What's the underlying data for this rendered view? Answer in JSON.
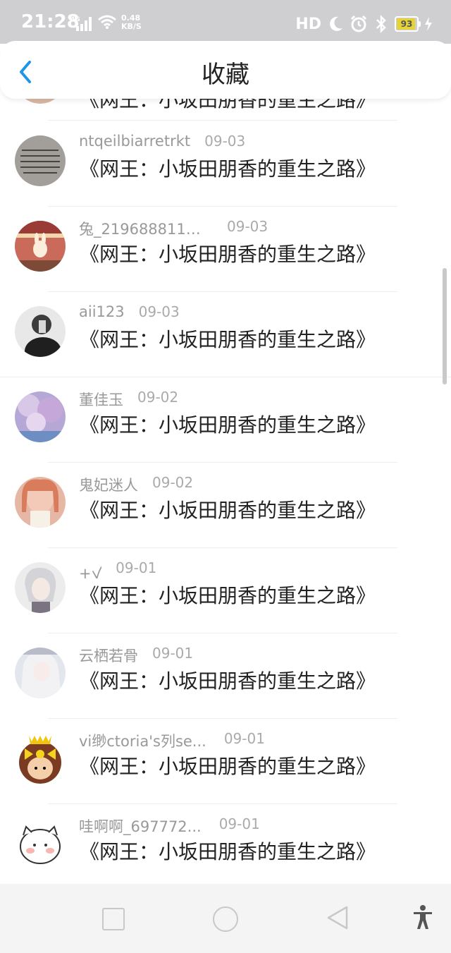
{
  "status_bar": {
    "time": "21:28",
    "network": "4G",
    "speed_value": "0.48",
    "speed_unit": "KB/S",
    "hd": "HD",
    "battery": "93"
  },
  "header": {
    "title": "收藏",
    "back_icon": "chevron-left-icon",
    "accent": "#1e96e8"
  },
  "list": {
    "partial_top": {
      "book": "《网王：小坂田朋香的重生之路》"
    },
    "items": [
      {
        "name": "ntqeilbiarretrkt",
        "date": "09-03",
        "book": "《网王：小坂田朋香的重生之路》"
      },
      {
        "name": "兔_2196888118...",
        "date": "09-03",
        "book": "《网王：小坂田朋香的重生之路》"
      },
      {
        "name": "aii123",
        "date": "09-03",
        "book": "《网王：小坂田朋香的重生之路》"
      },
      {
        "name": "董佳玉",
        "date": "09-02",
        "book": "《网王：小坂田朋香的重生之路》"
      },
      {
        "name": "鬼妃迷人",
        "date": "09-02",
        "book": "《网王：小坂田朋香的重生之路》"
      },
      {
        "name": "+ꪜ",
        "date": "09-01",
        "book": "《网王：小坂田朋香的重生之路》"
      },
      {
        "name": "云栖若骨",
        "date": "09-01",
        "book": "《网王：小坂田朋香的重生之路》"
      },
      {
        "name": "vi缈ctoria's列se...",
        "date": "09-01",
        "book": "《网王：小坂田朋香的重生之路》"
      },
      {
        "name": "哇啊啊_697772...",
        "date": "09-01",
        "book": "《网王：小坂田朋香的重生之路》"
      }
    ]
  },
  "nav_bar": {
    "icons": [
      "square-icon",
      "circle-icon",
      "triangle-back-icon",
      "accessibility-icon"
    ]
  }
}
